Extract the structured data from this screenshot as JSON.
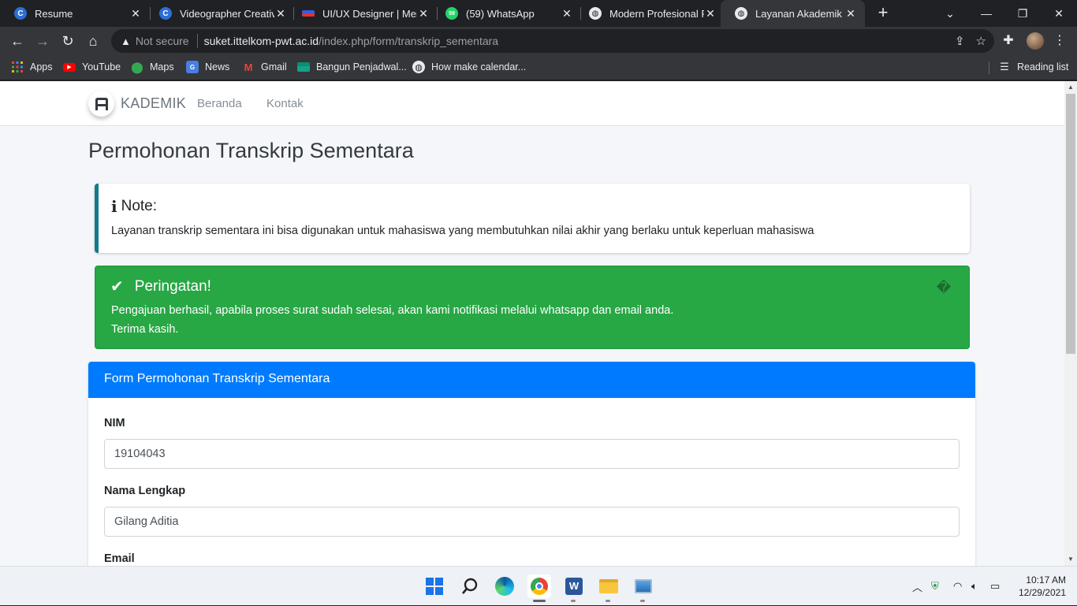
{
  "browser": {
    "tabs": [
      {
        "title": "Resume",
        "icon": "c-blue-icon"
      },
      {
        "title": "Videographer Creative",
        "icon": "c-blue-icon"
      },
      {
        "title": "UI/UX Designer | Merc",
        "icon": "flag-icon"
      },
      {
        "title": "(59) WhatsApp",
        "icon": "whatsapp-icon"
      },
      {
        "title": "Modern Profesional Re",
        "icon": "globe-icon"
      },
      {
        "title": "Layanan Akademik",
        "icon": "globe-icon",
        "active": true
      }
    ],
    "address": {
      "security": "Not secure",
      "host": "suket.ittelkom-pwt.ac.id",
      "path": "/index.php/form/transkrip_sementara"
    },
    "bookmarks": [
      {
        "label": "Apps",
        "icon": "apps-grid-icon"
      },
      {
        "label": "YouTube",
        "icon": "youtube-icon"
      },
      {
        "label": "Maps",
        "icon": "maps-pin-icon"
      },
      {
        "label": "News",
        "icon": "news-icon"
      },
      {
        "label": "Gmail",
        "icon": "gmail-icon"
      },
      {
        "label": "Bangun Penjadwal...",
        "icon": "bookmark-green-icon"
      },
      {
        "label": "How make calendar...",
        "icon": "globe-icon"
      }
    ],
    "reading_list": "Reading list"
  },
  "site": {
    "brand": "KADEMIK",
    "nav": [
      "Beranda",
      "Kontak"
    ],
    "page_title": "Permohonan Transkrip Sementara",
    "note": {
      "title": "Note:",
      "body": "Layanan transkrip sementara ini bisa digunakan untuk mahasiswa yang membutuhkan nilai akhir yang berlaku untuk keperluan mahasiswa"
    },
    "alert": {
      "title": "Peringatan!",
      "line1": "Pengajuan berhasil, apabila proses surat sudah selesai, akan kami notifikasi melalui whatsapp dan email anda.",
      "line2": "Terima kasih.",
      "dismiss": "�"
    },
    "form": {
      "header": "Form Permohonan Transkrip Sementara",
      "nim_label": "NIM",
      "nim_value": "19104043",
      "name_label": "Nama Lengkap",
      "name_value": "Gilang Aditia",
      "email_label": "Email"
    }
  },
  "taskbar": {
    "time": "10:17 AM",
    "date": "12/29/2021"
  },
  "colors": {
    "primary": "#007bff",
    "success": "#28a745",
    "info_border": "#117a8b"
  }
}
